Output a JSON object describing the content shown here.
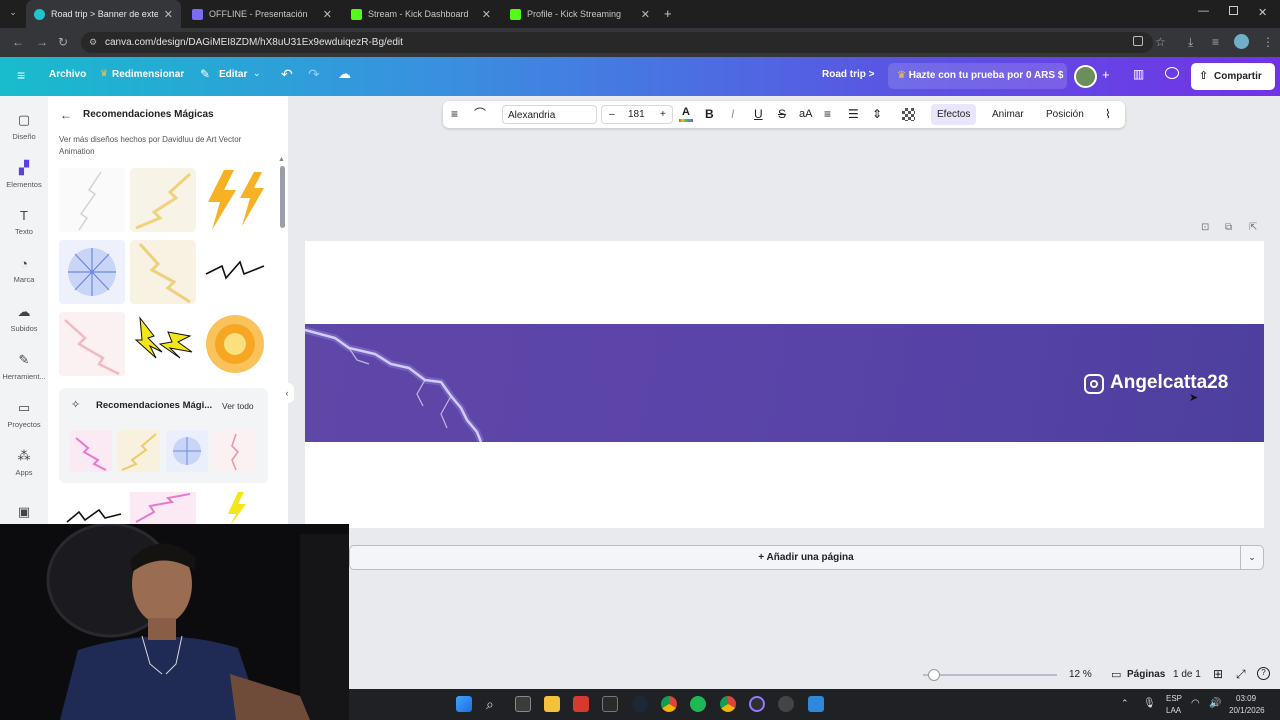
{
  "browser": {
    "tabs": [
      {
        "title": "Road trip > Banner de exterio",
        "active": true
      },
      {
        "title": "OFFLINE - Presentación",
        "active": false
      },
      {
        "title": "Stream - Kick Dashboard",
        "active": false
      },
      {
        "title": "Profile - Kick Streaming",
        "active": false
      }
    ],
    "url": "canva.com/design/DAGiMEI8ZDM/hX8uU31Ex9ewduiqezR-Bg/edit"
  },
  "header": {
    "file_label": "Archivo",
    "resize_label": "Redimensionar",
    "edit_label": "Editar",
    "project_title": "Road trip >",
    "trial_label": "Hazte con tu prueba por 0 ARS $",
    "share_label": "Compartir"
  },
  "sidebar": {
    "items": [
      {
        "label": "Diseño",
        "icon": "layout-icon"
      },
      {
        "label": "Elementos",
        "icon": "elements-icon"
      },
      {
        "label": "Texto",
        "icon": "text-icon"
      },
      {
        "label": "Marca",
        "icon": "brand-icon"
      },
      {
        "label": "Subidos",
        "icon": "upload-icon"
      },
      {
        "label": "Herramient...",
        "icon": "tools-icon"
      },
      {
        "label": "Proyectos",
        "icon": "folder-icon"
      },
      {
        "label": "Apps",
        "icon": "apps-icon"
      }
    ]
  },
  "panel": {
    "title": "Recomendaciones Mágicas",
    "subtitle": "Ver más diseños hechos por Davidluu de Art Vector Animation",
    "section_title": "Recomendaciones Mági...",
    "see_all": "Ver todo"
  },
  "toolbar": {
    "font": "Alexandria",
    "minus": "–",
    "size": "181",
    "plus": "+",
    "bold": "B",
    "italic": "I",
    "underline": "U",
    "strike": "S",
    "case": "aA",
    "effects": "Efectos",
    "animate": "Animar",
    "position": "Posición"
  },
  "canvas": {
    "banner_handle": "Angelcatta28",
    "add_page": "+ Añadir una página"
  },
  "footer": {
    "zoom": "12 %",
    "pages_label": "Páginas",
    "page_count": "1 de 1",
    "zoom_level": 0.05
  },
  "taskbar": {
    "lang": "ESP",
    "region": "LAA",
    "time": "03:09",
    "date": "20/1/2026"
  },
  "colors": {
    "accent": "#7232e6",
    "banner": "#5a44a6",
    "header_start": "#18bccc"
  }
}
